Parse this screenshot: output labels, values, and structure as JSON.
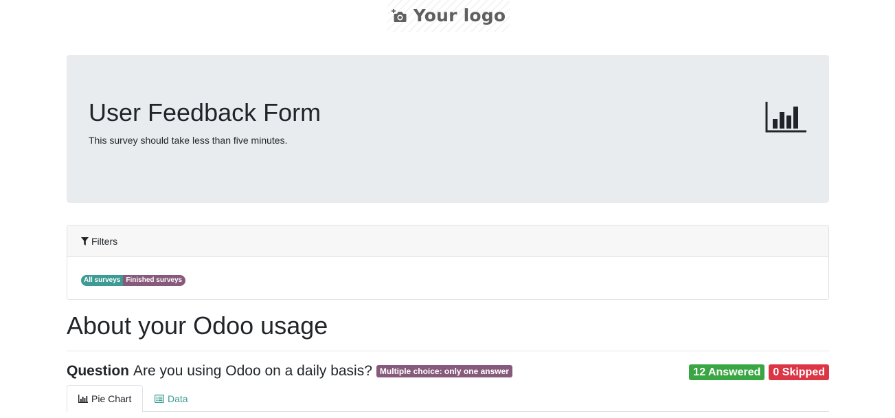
{
  "header": {
    "logo_text": "Your logo",
    "logo_icon": "camera-plus-icon"
  },
  "hero": {
    "title": "User Feedback Form",
    "subtitle": "This survey should take less than five minutes.",
    "icon": "bar-chart-icon"
  },
  "filters": {
    "header_label": "Filters",
    "icon": "filter-icon",
    "tags": [
      {
        "label": "All surveys",
        "color": "#3e9b94"
      },
      {
        "label": "Finished surveys",
        "color": "#875a7b"
      }
    ]
  },
  "section": {
    "title": "About your Odoo usage"
  },
  "question": {
    "prefix": "Question",
    "text": "Are you using Odoo on a daily basis?",
    "type_badge": "Multiple choice: only one answer",
    "answered_label": "12 Answered",
    "skipped_label": "0 Skipped",
    "answered_color": "#3aa643",
    "skipped_color": "#dc3545"
  },
  "tabs": [
    {
      "label": "Pie Chart",
      "icon": "bar-chart-icon",
      "active": true
    },
    {
      "label": "Data",
      "icon": "list-icon",
      "active": false
    }
  ],
  "colors": {
    "accent": "#3e9b94",
    "brand": "#875a7b",
    "hero_bg": "#e9ecef"
  }
}
